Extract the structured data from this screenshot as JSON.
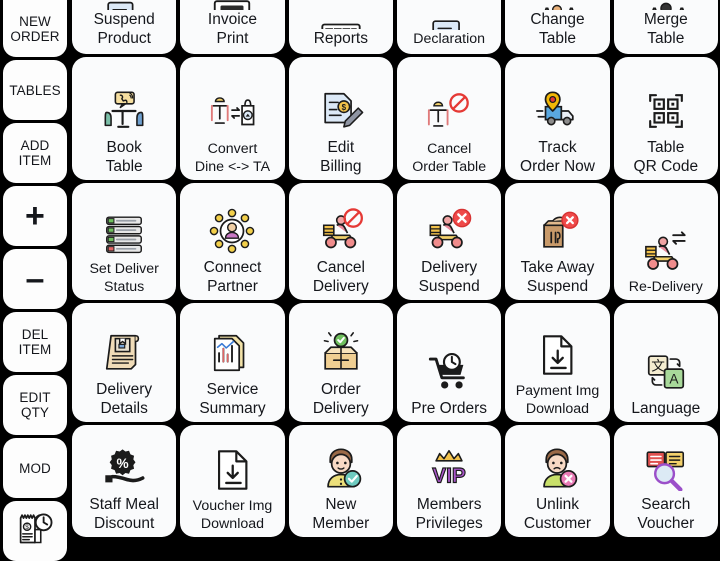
{
  "theme": {
    "background": "#000000",
    "tile_bg": "#fafbfc",
    "text": "#15171c"
  },
  "sidebar": {
    "items": [
      {
        "label": "NEW\nORDER",
        "name": "new-order",
        "kind": "text"
      },
      {
        "label": "TABLES",
        "name": "tables",
        "kind": "text"
      },
      {
        "label": "ADD\nITEM",
        "name": "add-item",
        "kind": "text"
      },
      {
        "label": "+",
        "name": "increase-qty",
        "kind": "big"
      },
      {
        "label": "–",
        "name": "decrease-qty",
        "kind": "big"
      },
      {
        "label": "DEL\nITEM",
        "name": "del-item",
        "kind": "text"
      },
      {
        "label": "EDIT\nQTY",
        "name": "edit-qty",
        "kind": "text"
      },
      {
        "label": "MOD",
        "name": "mod",
        "kind": "text"
      },
      {
        "label": "",
        "name": "order-history",
        "kind": "icon",
        "icon": "receipt-clock-icon"
      }
    ]
  },
  "grid": {
    "columns": 6,
    "rows": [
      {
        "row": 1,
        "clipped_top": true,
        "tiles": [
          {
            "label": "Suspend\nProduct",
            "icon": "suspend-product-icon"
          },
          {
            "label": "Invoice\nPrint",
            "icon": "invoice-print-icon"
          },
          {
            "label": "Reports",
            "icon": "reports-icon"
          },
          {
            "label": "Declaration",
            "icon": "declaration-icon"
          },
          {
            "label": "Change\nTable",
            "icon": "change-table-icon"
          },
          {
            "label": "Merge\nTable",
            "icon": "merge-table-icon"
          }
        ]
      },
      {
        "row": 2,
        "clipped_top": false,
        "tiles": [
          {
            "label": "Book\nTable",
            "icon": "book-table-icon"
          },
          {
            "label": "Convert\nDine <-> TA",
            "icon": "convert-dine-ta-icon"
          },
          {
            "label": "Edit\nBilling",
            "icon": "edit-billing-icon"
          },
          {
            "label": "Cancel\nOrder Table",
            "icon": "cancel-order-table-icon"
          },
          {
            "label": "Track\nOrder Now",
            "icon": "track-order-now-icon"
          },
          {
            "label": "Table\nQR Code",
            "icon": "table-qr-code-icon"
          }
        ]
      },
      {
        "row": 3,
        "clipped_top": false,
        "tiles": [
          {
            "label": "Set Deliver\nStatus",
            "icon": "set-deliver-status-icon"
          },
          {
            "label": "Connect\nPartner",
            "icon": "connect-partner-icon"
          },
          {
            "label": "Cancel\nDelivery",
            "icon": "cancel-delivery-icon"
          },
          {
            "label": "Delivery\nSuspend",
            "icon": "delivery-suspend-icon"
          },
          {
            "label": "Take Away\nSuspend",
            "icon": "take-away-suspend-icon"
          },
          {
            "label": "Re-Delivery",
            "icon": "re-delivery-icon"
          }
        ]
      },
      {
        "row": 4,
        "clipped_top": false,
        "tiles": [
          {
            "label": "Delivery\nDetails",
            "icon": "delivery-details-icon"
          },
          {
            "label": "Service\nSummary",
            "icon": "service-summary-icon"
          },
          {
            "label": "Order\nDelivery",
            "icon": "order-delivery-icon"
          },
          {
            "label": "Pre Orders",
            "icon": "pre-orders-icon"
          },
          {
            "label": "Payment Img\nDownload",
            "icon": "payment-img-download-icon"
          },
          {
            "label": "Language",
            "icon": "language-icon"
          }
        ]
      },
      {
        "row": 5,
        "clipped_top": false,
        "tiles": [
          {
            "label": "Staff Meal\nDiscount",
            "icon": "staff-meal-discount-icon"
          },
          {
            "label": "Voucher Img\nDownload",
            "icon": "voucher-img-download-icon"
          },
          {
            "label": "New\nMember",
            "icon": "new-member-icon"
          },
          {
            "label": "Members\nPrivileges",
            "icon": "members-privileges-icon"
          },
          {
            "label": "Unlink\nCustomer",
            "icon": "unlink-customer-icon"
          },
          {
            "label": "Search\nVoucher",
            "icon": "search-voucher-icon"
          }
        ]
      }
    ]
  }
}
